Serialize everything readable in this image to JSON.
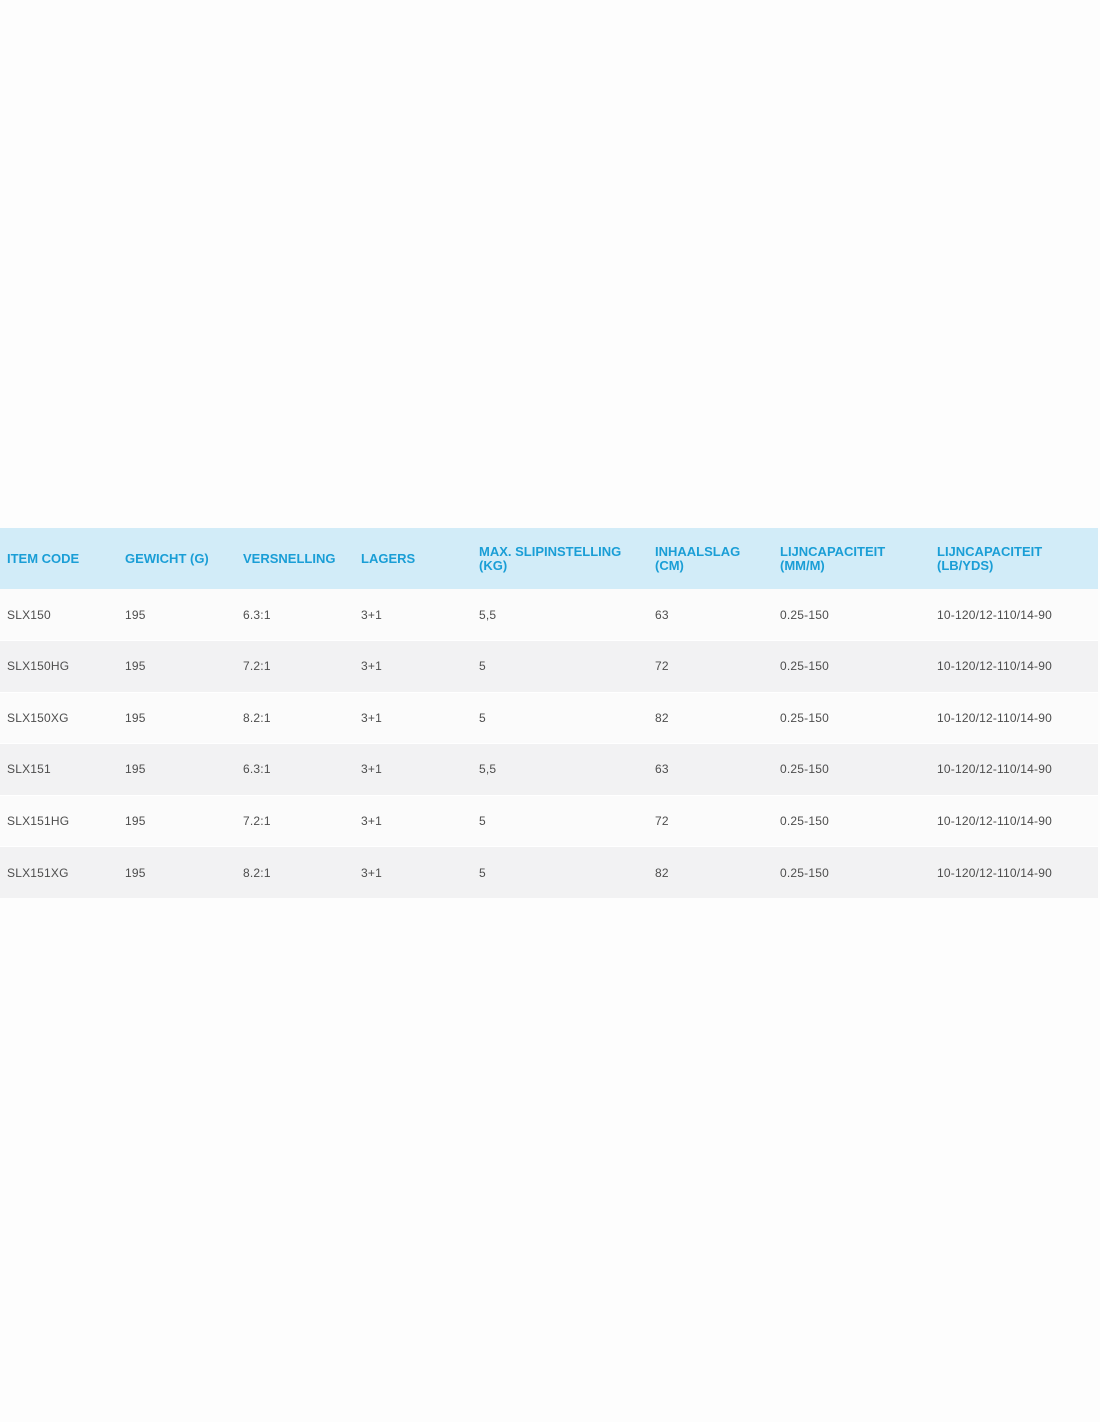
{
  "table": {
    "headers": [
      [
        "ITEM CODE"
      ],
      [
        "GEWICHT (G)"
      ],
      [
        "VERSNELLING"
      ],
      [
        "LAGERS"
      ],
      [
        "MAX. SLIPINSTELLING",
        "(KG)"
      ],
      [
        "INHAALSLAG",
        "(CM)"
      ],
      [
        "LIJNCAPACITEIT",
        "(MM/M)"
      ],
      [
        "LIJNCAPACITEIT",
        "(LB/YDS)"
      ]
    ],
    "rows": [
      [
        "SLX150",
        "195",
        "6.3:1",
        "3+1",
        "5,5",
        "63",
        "0.25-150",
        "10-120/12-110/14-90"
      ],
      [
        "SLX150HG",
        "195",
        "7.2:1",
        "3+1",
        "5",
        "72",
        "0.25-150",
        "10-120/12-110/14-90"
      ],
      [
        "SLX150XG",
        "195",
        "8.2:1",
        "3+1",
        "5",
        "82",
        "0.25-150",
        "10-120/12-110/14-90"
      ],
      [
        "SLX151",
        "195",
        "6.3:1",
        "3+1",
        "5,5",
        "63",
        "0.25-150",
        "10-120/12-110/14-90"
      ],
      [
        "SLX151HG",
        "195",
        "7.2:1",
        "3+1",
        "5",
        "72",
        "0.25-150",
        "10-120/12-110/14-90"
      ],
      [
        "SLX151XG",
        "195",
        "8.2:1",
        "3+1",
        "5",
        "82",
        "0.25-150",
        "10-120/12-110/14-90"
      ]
    ]
  },
  "colors": {
    "header_background": "#d2ecf8",
    "header_text": "#1a9ed6",
    "body_text": "#4d4d4d",
    "row_light": "#fbfbfb",
    "row_dark": "#f2f2f3"
  }
}
